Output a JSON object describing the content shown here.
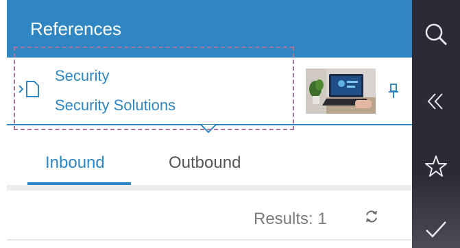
{
  "header": {
    "title": "References"
  },
  "reference": {
    "title": "Security",
    "subtitle": "Security Solutions",
    "icon": "document-arrow-icon",
    "thumbnail": "laptop-photo",
    "pin_icon": "pin-icon"
  },
  "tabs": [
    {
      "label": "Inbound",
      "active": true
    },
    {
      "label": "Outbound",
      "active": false
    }
  ],
  "results": {
    "label": "Results: 1",
    "refresh_icon": "refresh-icon"
  },
  "rail": {
    "icons": [
      "search-icon",
      "collapse-icon",
      "star-icon",
      "check-icon"
    ]
  },
  "colors": {
    "accent": "#2f86c3",
    "rail": "#2c2a35",
    "selection": "#a6739e"
  }
}
